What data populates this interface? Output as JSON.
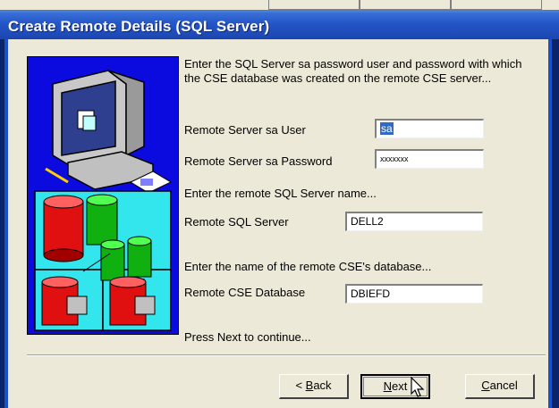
{
  "window": {
    "title": "Create Remote Details (SQL Server)"
  },
  "intro_text": "Enter the SQL Server sa password user and password with which the CSE database was created on the remote CSE server...",
  "fields": {
    "sa_user": {
      "label": "Remote Server sa User",
      "value": "sa"
    },
    "sa_password": {
      "label": "Remote Server sa Password",
      "value": "xxxxxxx"
    },
    "server_prompt": "Enter the remote SQL Server name...",
    "sql_server": {
      "label": "Remote SQL Server",
      "value": "DELL2"
    },
    "database_prompt": "Enter the name of the remote CSE's database...",
    "cse_database": {
      "label": "Remote CSE Database",
      "value": "DBIEFD"
    }
  },
  "continue_text": "Press Next to continue...",
  "buttons": {
    "back": {
      "prefix": "< ",
      "mnemonic": "B",
      "rest": "ack"
    },
    "next": {
      "mnemonic": "N",
      "rest": "ext"
    },
    "cancel": {
      "mnemonic": "C",
      "rest": "ancel"
    }
  },
  "icons": [
    "computer-illustration",
    "database-cylinders-illustration",
    "mouse-cursor-icon"
  ],
  "colors": {
    "titlebar": "#2456c8",
    "dialog_bg": "#ece9d8",
    "art_bg": "#0b0be0",
    "selection": "#316ac5"
  }
}
